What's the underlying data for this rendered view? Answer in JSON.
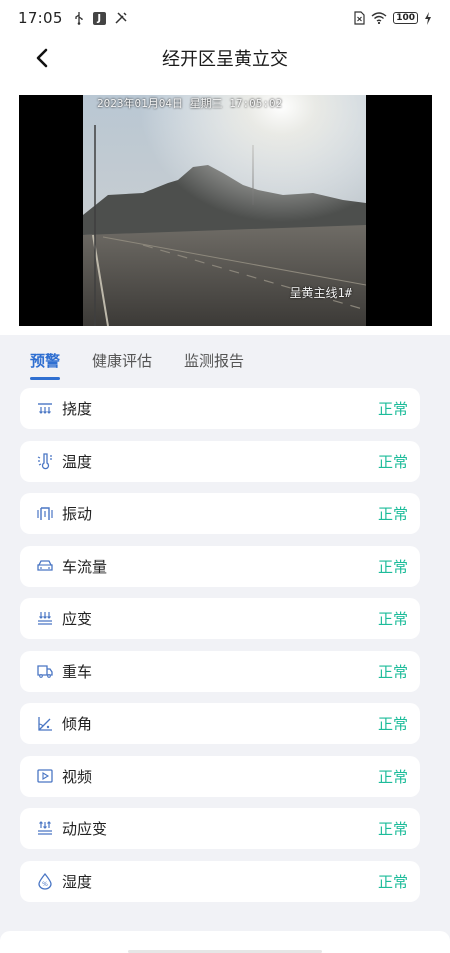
{
  "status_bar": {
    "time": "17:05",
    "battery": "100"
  },
  "header": {
    "title": "经开区呈黄立交"
  },
  "video": {
    "timestamp_overlay": "2023年01月04日  星期三  17:05:02",
    "camera_label": "呈黄主线1#"
  },
  "tabs": [
    {
      "label": "预警",
      "active": true
    },
    {
      "label": "健康评估",
      "active": false
    },
    {
      "label": "监测报告",
      "active": false
    }
  ],
  "items": [
    {
      "label": "挠度",
      "status": "正常",
      "icon": "deflection-icon"
    },
    {
      "label": "温度",
      "status": "正常",
      "icon": "temperature-icon"
    },
    {
      "label": "振动",
      "status": "正常",
      "icon": "vibration-icon"
    },
    {
      "label": "车流量",
      "status": "正常",
      "icon": "car-icon"
    },
    {
      "label": "应变",
      "status": "正常",
      "icon": "strain-icon"
    },
    {
      "label": "重车",
      "status": "正常",
      "icon": "truck-icon"
    },
    {
      "label": "倾角",
      "status": "正常",
      "icon": "tilt-angle-icon"
    },
    {
      "label": "视频",
      "status": "正常",
      "icon": "video-icon"
    },
    {
      "label": "动应变",
      "status": "正常",
      "icon": "dynamic-strain-icon"
    },
    {
      "label": "湿度",
      "status": "正常",
      "icon": "humidity-icon"
    }
  ],
  "colors": {
    "accent": "#2f6fd1",
    "status_ok": "#1dbc9a",
    "icon_blue": "#4a76c4",
    "background": "#f1f2f6"
  }
}
